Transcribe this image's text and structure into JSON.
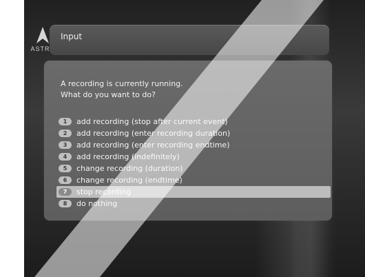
{
  "logo": {
    "text": "ASTRA"
  },
  "header": {
    "title": "Input"
  },
  "dialog": {
    "message_line1": "A recording is currently running.",
    "message_line2": "What do you want to do?",
    "options": [
      {
        "num": "1",
        "label": "add recording (stop after current event)"
      },
      {
        "num": "2",
        "label": "add recording (enter recording duration)"
      },
      {
        "num": "3",
        "label": "add recording (enter recording endtime)"
      },
      {
        "num": "4",
        "label": "add recording (indefinitely)"
      },
      {
        "num": "5",
        "label": "change recording (duration)"
      },
      {
        "num": "6",
        "label": "change recording (endtime)"
      },
      {
        "num": "7",
        "label": "stop recording"
      },
      {
        "num": "8",
        "label": "do nothing"
      }
    ],
    "selected_index": 6
  },
  "colors": {
    "background": "#2a2a2a",
    "panel": "#5e5e5e",
    "selection": "#bdbdbd"
  }
}
